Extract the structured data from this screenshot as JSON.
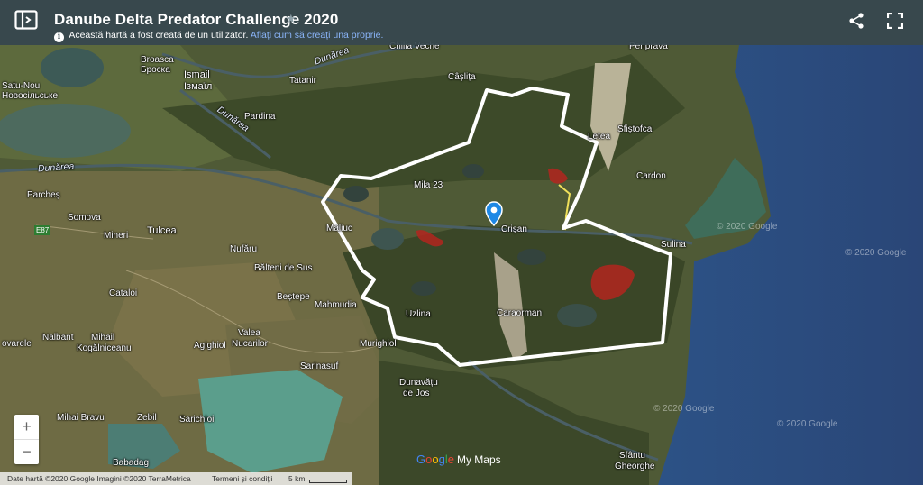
{
  "header": {
    "title": "Danube Delta Predator Challenge 2020",
    "notice": "Această hartă a fost creată de un utilizator.",
    "notice_link": "Aflați cum să creați una proprie."
  },
  "map": {
    "places": {
      "satu_nou": "Satu-Nou",
      "satu_nou_cyr": "Новосільське",
      "broasca": "Broasca",
      "broasca_cyr": "Броска",
      "ismail": "Ismail",
      "ismail_cyr": "Ізмаїл",
      "tatanir": "Tatanir",
      "caslita": "Câșlița",
      "pardina": "Pardina",
      "letea": "Letea",
      "sfistofca": "Sfiștofca",
      "cardon": "Cardon",
      "parches": "Parcheș",
      "somova": "Somova",
      "mila23": "Mila 23",
      "mineri": "Mineri",
      "tulcea": "Tulcea",
      "maliuc": "Maliuc",
      "crisan": "Crișan",
      "sulina": "Sulina",
      "nufaru": "Nufăru",
      "baltenii": "Bălteni de Sus",
      "catalo": "Cataloi",
      "bestepe": "Beștepe",
      "mahmudia": "Mahmudia",
      "uzlina": "Uzlina",
      "caraorman": "Caraorman",
      "nalbant": "Nalbant",
      "valea": "Valea",
      "nucarilor": "Nucarilor",
      "kogalniceanu": "Kogălniceanu",
      "mihail": "Mihail",
      "vovarele": "ovarele",
      "agighiol": "Agighiol",
      "murighiol": "Murighiol",
      "sarinasuf": "Sarinasuf",
      "dunavatu": "Dunavățu",
      "dejos": "de Jos",
      "mihai_bravu": "Mihai Bravu",
      "zebil": "Zebil",
      "sarichioi": "Sarichioi",
      "babadag": "Babadag",
      "sfantu": "Sfântu",
      "gheorghe": "Gheorghe",
      "chilia": "Chilia Veche",
      "top_right_town": "Periprava"
    },
    "rivers": {
      "dunarea1": "Dunărea",
      "dunarea2": "Dunărea",
      "dunarea3": "Dunărea"
    },
    "roads": {
      "e87": "E87"
    },
    "watermarks": [
      "© 2020 Google",
      "© 2020 Google",
      "© 2020 Google",
      "© 2020 Google"
    ]
  },
  "controls": {
    "zoom_in": "+",
    "zoom_out": "−"
  },
  "logo": {
    "g1": "G",
    "g2": "o",
    "g3": "o",
    "g4": "g",
    "g5": "l",
    "g6": "e",
    "suffix": "My Maps"
  },
  "footer": {
    "attribution": "Date hartă ©2020 Google Imagini ©2020 TerraMetrica",
    "terms": "Termeni și condiții",
    "scale": "5 km"
  },
  "colors": {
    "boundary": "#ffffff",
    "zone_fill": "#b3261e",
    "pin": "#1e88e5",
    "header_bg": "#37474f",
    "sea": "#2a4a7a"
  },
  "icons": [
    "sidebar-toggle-icon",
    "star-icon",
    "info-icon",
    "share-icon",
    "fullscreen-icon",
    "location-pin-icon"
  ]
}
